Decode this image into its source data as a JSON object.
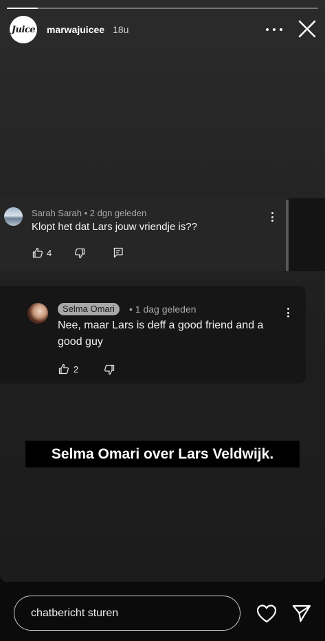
{
  "story": {
    "progress": 0.1,
    "account": {
      "username": "marwajuicee",
      "time": "18u",
      "logo_text": "Juice"
    },
    "icons": {
      "more": "more-horizontal-icon",
      "close": "close-icon"
    }
  },
  "comments": [
    {
      "author": "Sarah Sarah",
      "age": "• 2 dgn geleden",
      "text": "Klopt het dat Lars jouw vriendje is??",
      "likes": "4"
    },
    {
      "author": "Selma Omari",
      "age": "• 1 dag geleden",
      "text": "Nee, maar Lars is deff a good friend and a good guy",
      "likes": "2"
    }
  ],
  "caption": "Selma Omari over Lars Veldwijk.",
  "footer": {
    "message_placeholder": "chatbericht sturen",
    "icons": {
      "like": "heart-icon",
      "send": "send-icon"
    }
  }
}
